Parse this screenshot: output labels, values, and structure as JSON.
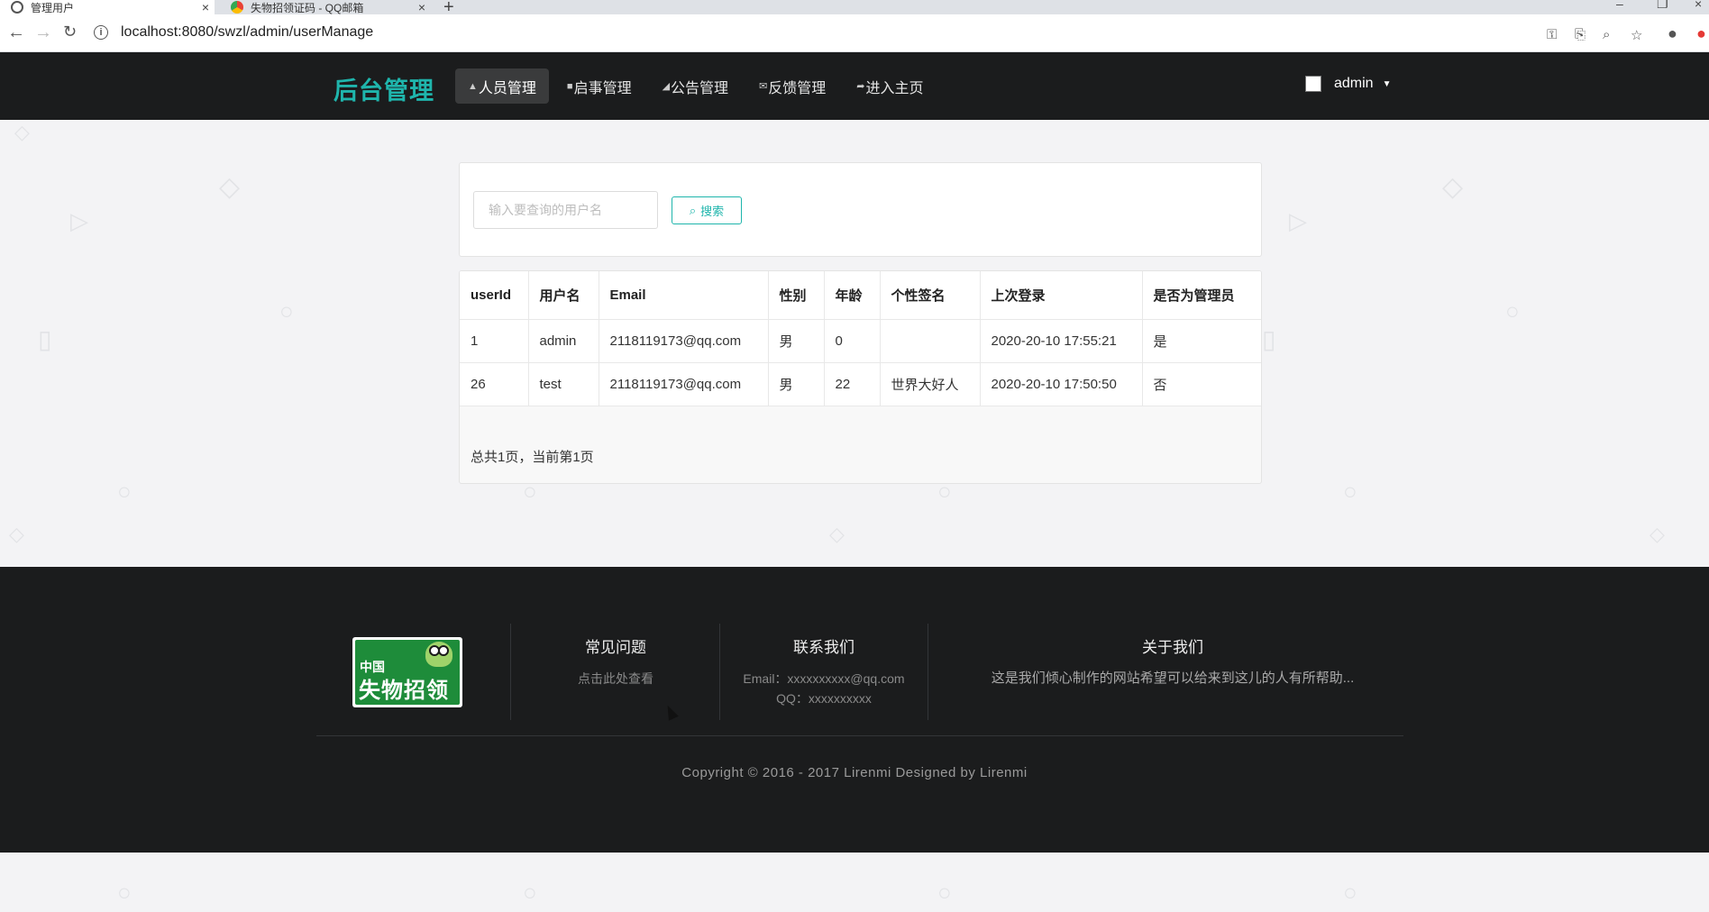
{
  "browser": {
    "tabs": [
      {
        "title": "管理用户",
        "active": true
      },
      {
        "title": "失物招领证码 - QQ邮箱",
        "active": false
      }
    ],
    "new_tab": "+",
    "url": "localhost:8080/swzl/admin/userManage"
  },
  "header": {
    "brand": "后台管理",
    "nav": [
      {
        "label": "人员管理",
        "icon": "user-icon",
        "active": true
      },
      {
        "label": "启事管理",
        "icon": "file-icon",
        "active": false
      },
      {
        "label": "公告管理",
        "icon": "bullhorn-icon",
        "active": false
      },
      {
        "label": "反馈管理",
        "icon": "envelope-icon",
        "active": false
      },
      {
        "label": "进入主页",
        "icon": "share-icon",
        "active": false
      }
    ],
    "user": {
      "name": "admin"
    }
  },
  "search": {
    "placeholder": "输入要查询的用户名",
    "value": "",
    "button_label": "搜索"
  },
  "table": {
    "columns": [
      "userId",
      "用户名",
      "Email",
      "性别",
      "年龄",
      "个性签名",
      "上次登录",
      "是否为管理员"
    ],
    "rows": [
      [
        "1",
        "admin",
        "2118119173@qq.com",
        "男",
        "0",
        "",
        "2020-20-10 17:55:21",
        "是"
      ],
      [
        "26",
        "test",
        "2118119173@qq.com",
        "男",
        "22",
        "世界大好人",
        "2020-20-10 17:50:50",
        "否"
      ]
    ],
    "pagination": "总共1页，当前第1页"
  },
  "footer": {
    "logo_text_top": "中国",
    "logo_text": "失物招领",
    "faq": {
      "heading": "常见问题",
      "link": "点击此处查看"
    },
    "contact": {
      "heading": "联系我们",
      "email": "Email：xxxxxxxxxx@qq.com",
      "qq": "QQ：xxxxxxxxxx"
    },
    "about": {
      "heading": "关于我们",
      "text": "这是我们倾心制作的网站希望可以给来到这儿的人有所帮助..."
    },
    "copyright": "Copyright © 2016 - 2017 Lirenmi Designed by Lirenmi"
  },
  "colors": {
    "accent": "#1fb5ac",
    "header_bg": "#1b1c1d",
    "page_bg": "#f3f3f5"
  }
}
